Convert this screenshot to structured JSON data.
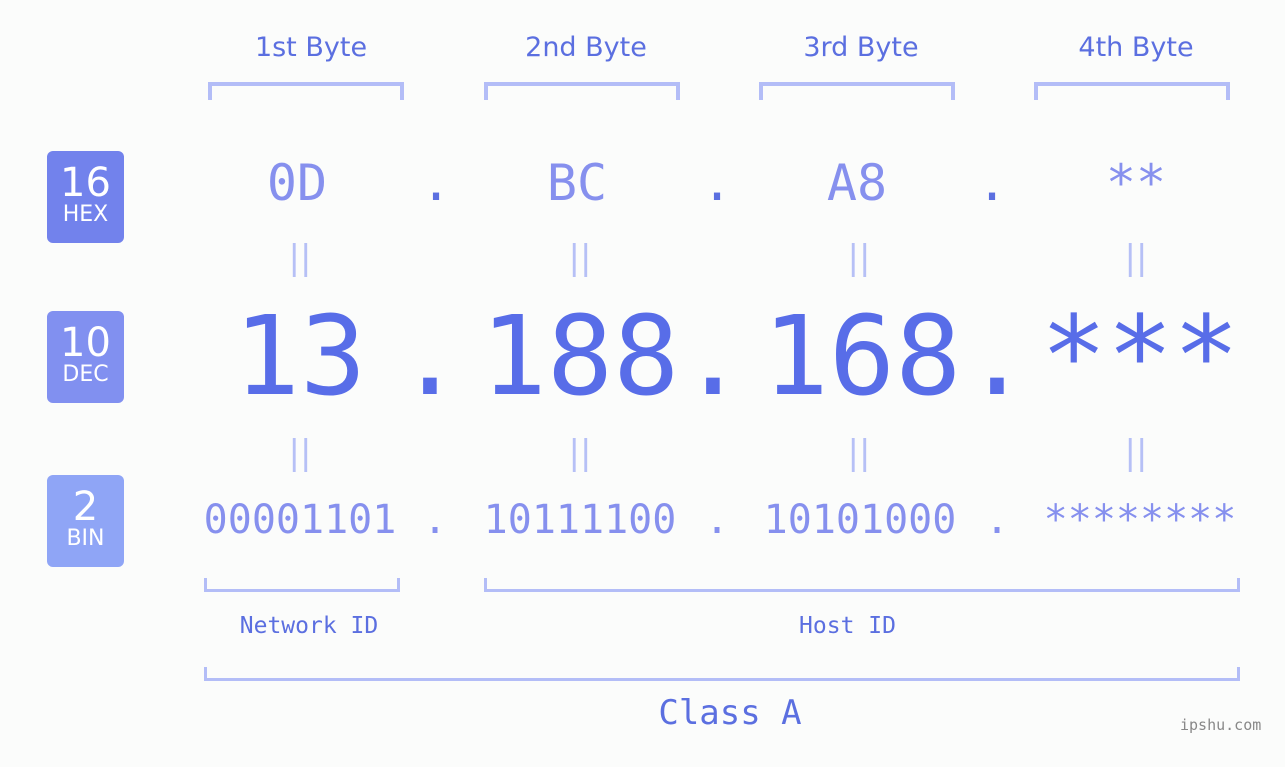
{
  "bytes": [
    {
      "label": "1st Byte",
      "hex": "0D",
      "dec": "13",
      "bin": "00001101"
    },
    {
      "label": "2nd Byte",
      "hex": "BC",
      "dec": "188",
      "bin": "10111100"
    },
    {
      "label": "3rd Byte",
      "hex": "A8",
      "dec": "168",
      "bin": "10101000"
    },
    {
      "label": "4th Byte",
      "hex": "**",
      "dec": "***",
      "bin": "********"
    }
  ],
  "separator": ".",
  "equals": "||",
  "badges": {
    "hex": {
      "number": "16",
      "label": "HEX",
      "color": "#7282ec"
    },
    "dec": {
      "number": "10",
      "label": "DEC",
      "color": "#8190f0"
    },
    "bin": {
      "number": "2",
      "label": "BIN",
      "color": "#8fa5f6"
    }
  },
  "segments": {
    "network": "Network ID",
    "host": "Host ID",
    "class": "Class A"
  },
  "watermark": "ipshu.com"
}
